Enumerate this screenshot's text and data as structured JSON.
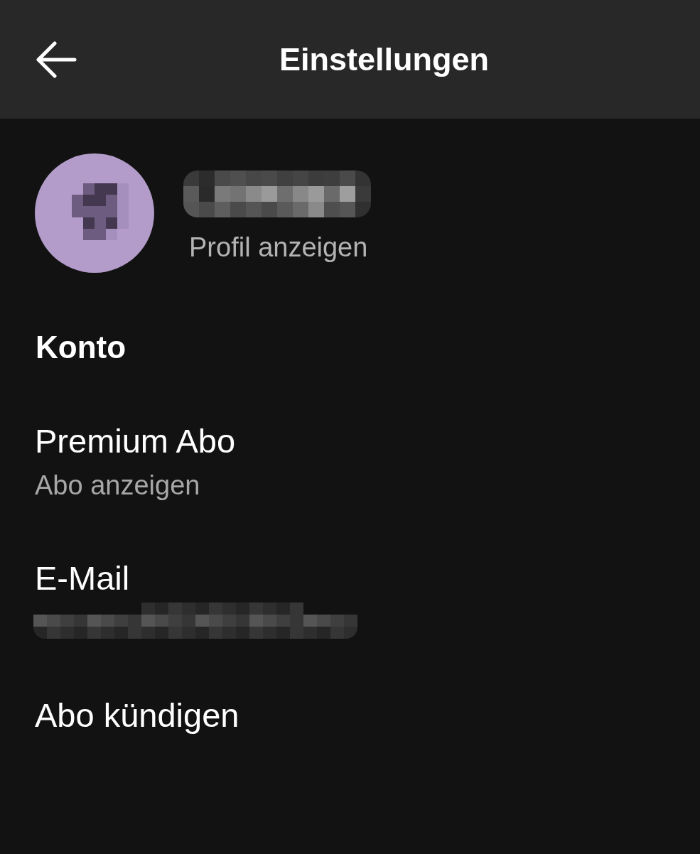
{
  "header": {
    "title": "Einstellungen"
  },
  "profile": {
    "link": "Profil anzeigen"
  },
  "sections": [
    {
      "title": "Konto",
      "items": [
        {
          "kind": "row",
          "label": "Premium Abo",
          "subtitle": "Abo anzeigen"
        },
        {
          "kind": "masked",
          "label": "E-Mail"
        },
        {
          "kind": "row",
          "label": "Abo kündigen"
        }
      ]
    }
  ]
}
